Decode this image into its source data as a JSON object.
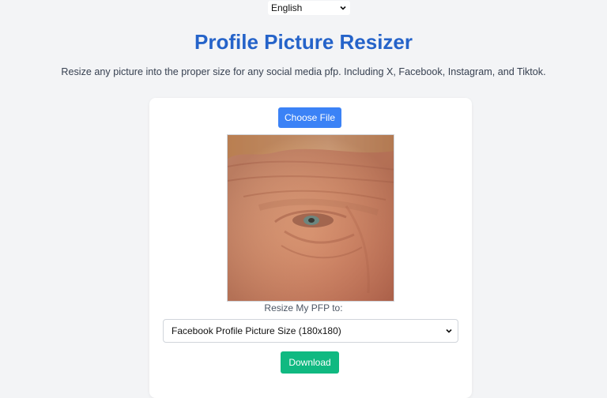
{
  "language": {
    "selected": "English"
  },
  "header": {
    "title": "Profile Picture Resizer",
    "subtitle": "Resize any picture into the proper size for any social media pfp. Including X, Facebook, Instagram, and Tiktok."
  },
  "uploader": {
    "choose_label": "Choose File"
  },
  "resize": {
    "label": "Resize My PFP to:",
    "selected_option": "Facebook Profile Picture Size (180x180)"
  },
  "actions": {
    "download_label": "Download"
  },
  "colors": {
    "title": "#2563c9",
    "choose_button": "#3b82f6",
    "download_button": "#10b981",
    "page_background": "#f3f4f6"
  },
  "icons": {
    "language_dropdown": "chevron-down-icon",
    "size_dropdown": "chevron-down-icon"
  }
}
